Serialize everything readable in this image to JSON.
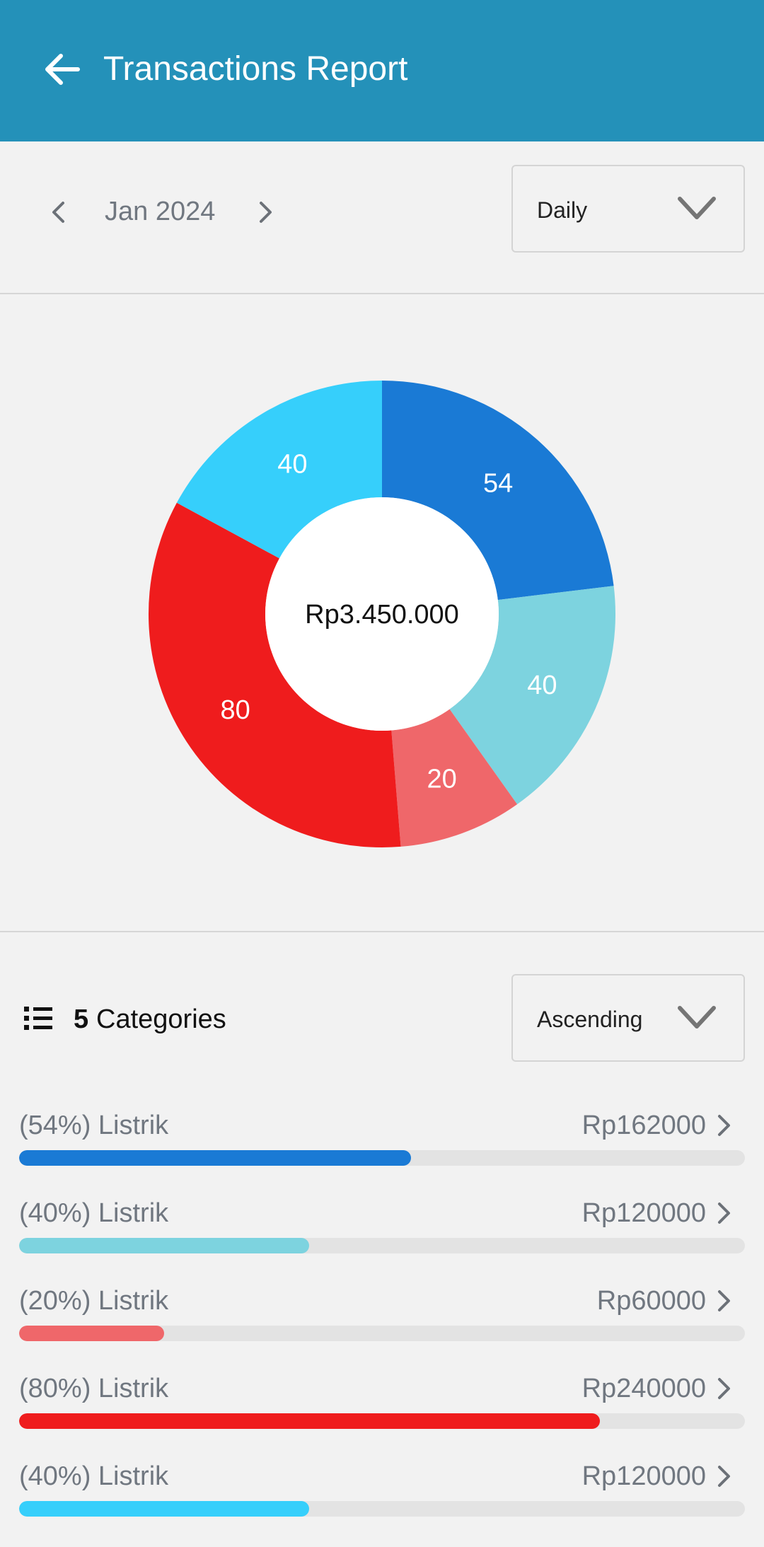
{
  "header": {
    "title": "Transactions Report"
  },
  "period": {
    "label": "Jan 2024",
    "mode": "Daily"
  },
  "chart_data": {
    "type": "pie",
    "variant": "donut",
    "center_label": "Rp3.450.000",
    "slices": [
      {
        "label": "54",
        "value": 54,
        "color": "#1a7ad5"
      },
      {
        "label": "40",
        "value": 40,
        "color": "#7dd3df"
      },
      {
        "label": "20",
        "value": 20,
        "color": "#ef676a"
      },
      {
        "label": "80",
        "value": 80,
        "color": "#ef1c1d"
      },
      {
        "label": "40",
        "value": 40,
        "color": "#36cffb"
      }
    ]
  },
  "categories": {
    "count": "5",
    "label": "Categories",
    "sort": "Ascending",
    "items": [
      {
        "label": "(54%) Listrik",
        "amount": "Rp162000",
        "percent": 54,
        "color": "#1a7ad5"
      },
      {
        "label": "(40%) Listrik",
        "amount": "Rp120000",
        "percent": 40,
        "color": "#7dd3df"
      },
      {
        "label": "(20%) Listrik",
        "amount": "Rp60000",
        "percent": 20,
        "color": "#ef676a"
      },
      {
        "label": "(80%) Listrik",
        "amount": "Rp240000",
        "percent": 80,
        "color": "#ef1c1d"
      },
      {
        "label": "(40%) Listrik",
        "amount": "Rp120000",
        "percent": 40,
        "color": "#36cffb"
      }
    ]
  }
}
